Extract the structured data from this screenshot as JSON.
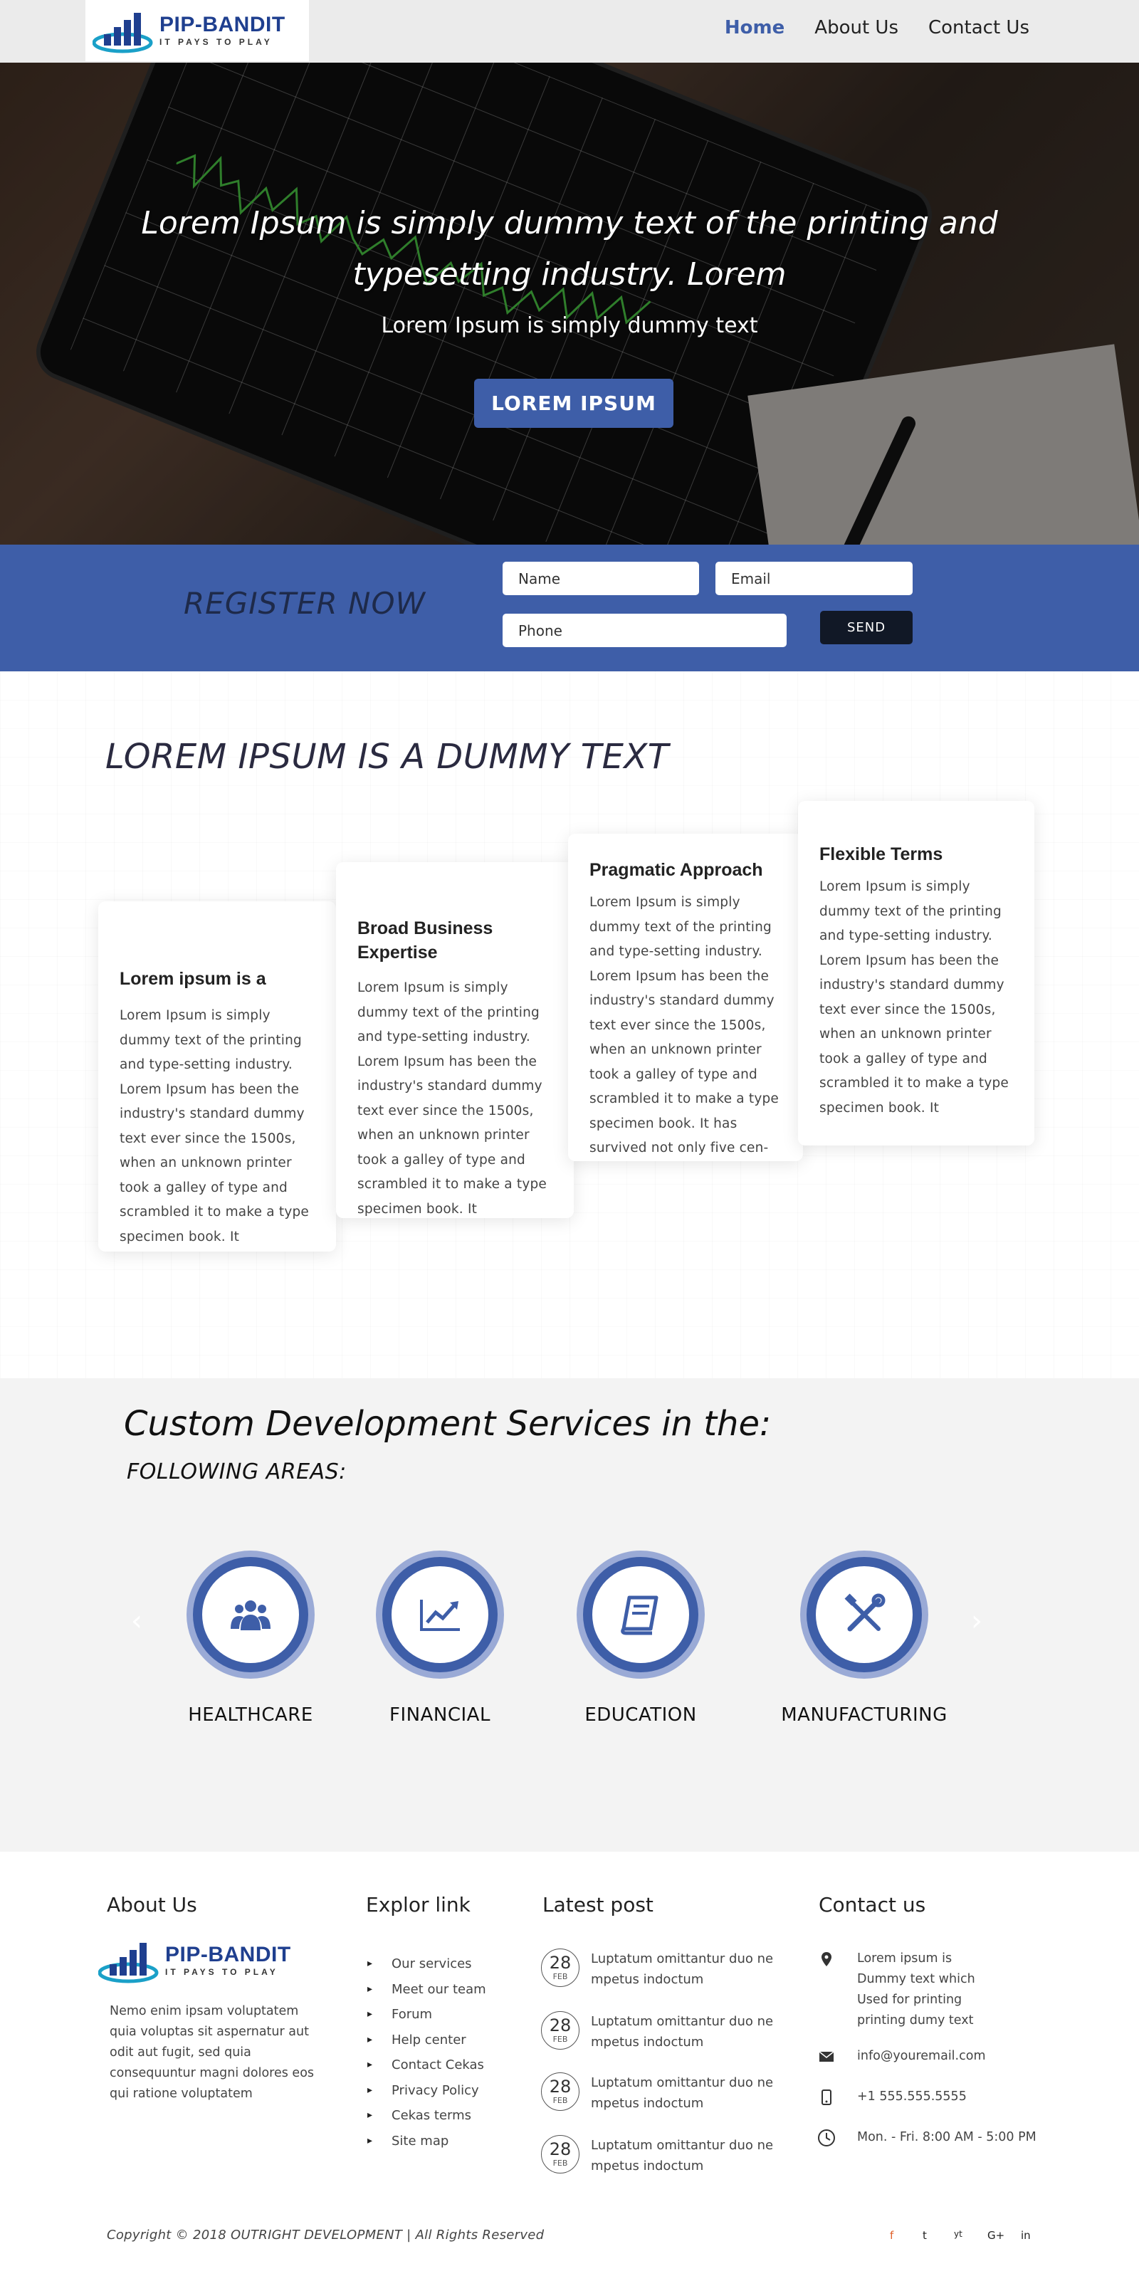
{
  "brand": {
    "name": "PIP-BANDIT",
    "tagline": "IT PAYS TO PLAY",
    "primary_color": "#3e5ea8"
  },
  "nav": {
    "items": [
      {
        "label": "Home",
        "active": true
      },
      {
        "label": "About Us",
        "active": false
      },
      {
        "label": "Contact Us",
        "active": false
      }
    ]
  },
  "hero": {
    "title": "Lorem Ipsum is simply dummy text of the printing and typesetting industry. Lorem",
    "subtitle": "Lorem Ipsum is simply dummy text",
    "button_label": "LOREM IPSUM"
  },
  "register": {
    "title": "REGISTER NOW",
    "name_placeholder": "Name",
    "email_placeholder": "Email",
    "phone_placeholder": "Phone",
    "send_label": "SEND"
  },
  "features": {
    "title": "LOREM IPSUM IS A DUMMY TEXT",
    "cards": [
      {
        "title": "Lorem ipsum is a",
        "text": "Lorem Ipsum is simply dummy text of the printing and type-setting industry. Lorem Ipsum has been the industry's standard dummy text ever since the 1500s, when an unknown printer took a galley of type and scrambled it to make a type specimen book. It"
      },
      {
        "title": "Broad Business Expertise",
        "text": "Lorem Ipsum is simply dummy text of the printing and type-setting industry. Lorem Ipsum has been the industry's standard dummy text ever since the 1500s, when an unknown printer took a galley of type and scrambled it to make a type specimen book. It"
      },
      {
        "title": "Pragmatic Approach",
        "text": "Lorem Ipsum is simply dummy text of the printing and type-setting industry. Lorem Ipsum has been the industry's standard dummy text ever since the 1500s, when an unknown printer took a galley of type and scrambled it to make a type specimen book. It has survived not only five cen-"
      },
      {
        "title": "Flexible Terms",
        "text": "Lorem Ipsum is simply dummy text of the printing and type-setting industry. Lorem Ipsum has been the industry's standard dummy text ever since the 1500s, when an unknown printer took a galley of type and scrambled it to make a type specimen book. It"
      }
    ]
  },
  "services": {
    "title": "Custom Development Services in the:",
    "subtitle": "FOLLOWING AREAS:",
    "prev_arrow": "‹",
    "next_arrow": "›",
    "items": [
      {
        "label": "HEALTHCARE",
        "icon": "users-icon"
      },
      {
        "label": "FINANCIAL",
        "icon": "chart-line-icon"
      },
      {
        "label": "EDUCATION",
        "icon": "book-icon"
      },
      {
        "label": "MANUFACTURING",
        "icon": "tools-icon"
      }
    ]
  },
  "footer": {
    "about": {
      "heading": "About Us",
      "text": "Nemo enim ipsam voluptatem quia voluptas sit aspernatur aut odit aut fugit, sed quia consequuntur magni dolores eos qui ratione voluptatem"
    },
    "links": {
      "heading": "Explor link",
      "items": [
        "Our services",
        "Meet our team",
        "Forum",
        "Help center",
        "Contact Cekas",
        "Privacy Policy",
        "Cekas terms",
        "Site map"
      ]
    },
    "posts": {
      "heading": "Latest post",
      "items": [
        {
          "day": "28",
          "month": "FEB",
          "text": "Luptatum omittantur duo ne mpetus indoctum"
        },
        {
          "day": "28",
          "month": "FEB",
          "text": "Luptatum omittantur duo ne mpetus indoctum"
        },
        {
          "day": "28",
          "month": "FEB",
          "text": "Luptatum omittantur duo ne mpetus indoctum"
        },
        {
          "day": "28",
          "month": "FEB",
          "text": "Luptatum omittantur duo ne mpetus indoctum"
        }
      ]
    },
    "contact": {
      "heading": "Contact us",
      "address": "Lorem ipsum is Dummy text which Used for  printing printing dumy text",
      "email": "info@youremail.com",
      "phone": "+1 555.555.5555",
      "hours": "Mon. - Fri. 8:00 AM - 5:00 PM"
    },
    "copyright": "Copyright © 2018 OUTRIGHT DEVELOPMENT  |   All Rights Reserved",
    "social": [
      "f",
      "t",
      "yt",
      "G+",
      "in"
    ]
  }
}
